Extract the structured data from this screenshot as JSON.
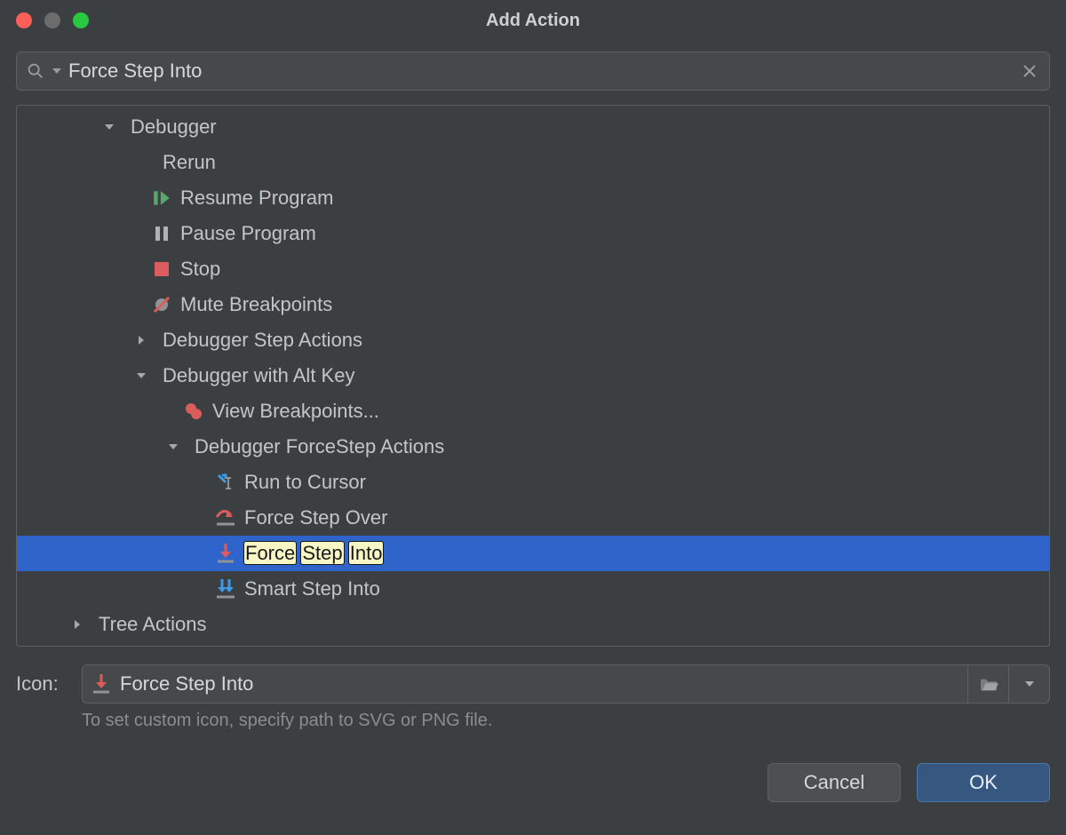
{
  "window": {
    "title": "Add Action"
  },
  "search": {
    "value": "Force Step Into"
  },
  "tree": {
    "items": [
      {
        "level": 2,
        "arrow": "down",
        "icon": null,
        "label": "Debugger",
        "selected": false,
        "highlight": []
      },
      {
        "level": 3,
        "arrow": null,
        "icon": null,
        "label": "Rerun",
        "selected": false,
        "highlight": []
      },
      {
        "level": 3,
        "arrow": null,
        "icon": "resume",
        "label": "Resume Program",
        "selected": false,
        "highlight": []
      },
      {
        "level": 3,
        "arrow": null,
        "icon": "pause",
        "label": "Pause Program",
        "selected": false,
        "highlight": []
      },
      {
        "level": 3,
        "arrow": null,
        "icon": "stop",
        "label": "Stop",
        "selected": false,
        "highlight": []
      },
      {
        "level": 3,
        "arrow": null,
        "icon": "mute-bp",
        "label": "Mute Breakpoints",
        "selected": false,
        "highlight": []
      },
      {
        "level": 3,
        "arrow": "right",
        "icon": null,
        "label": "Debugger Step Actions",
        "selected": false,
        "highlight": []
      },
      {
        "level": 3,
        "arrow": "down",
        "icon": null,
        "label": "Debugger with Alt Key",
        "selected": false,
        "highlight": []
      },
      {
        "level": 4,
        "arrow": null,
        "icon": "view-bp",
        "label": "View Breakpoints...",
        "selected": false,
        "highlight": []
      },
      {
        "level": 4,
        "arrow": "down",
        "icon": null,
        "label": "Debugger ForceStep Actions",
        "selected": false,
        "highlight": []
      },
      {
        "level": 5,
        "arrow": null,
        "icon": "run-cursor",
        "label": "Run to Cursor",
        "selected": false,
        "highlight": []
      },
      {
        "level": 5,
        "arrow": null,
        "icon": "force-over",
        "label": "Force Step Over",
        "selected": false,
        "highlight": []
      },
      {
        "level": 5,
        "arrow": null,
        "icon": "force-into",
        "label": "Force Step Into",
        "selected": true,
        "highlight": [
          "Force",
          "Step",
          "Into"
        ]
      },
      {
        "level": 5,
        "arrow": null,
        "icon": "smart-into",
        "label": "Smart Step Into",
        "selected": false,
        "highlight": []
      },
      {
        "level": 1,
        "arrow": "right",
        "icon": null,
        "label": "Tree Actions",
        "selected": false,
        "highlight": []
      }
    ]
  },
  "iconField": {
    "label": "Icon:",
    "icon": "force-into",
    "name": "Force Step Into",
    "hint": "To set custom icon, specify path to SVG or PNG file."
  },
  "buttons": {
    "cancel": "Cancel",
    "ok": "OK"
  }
}
